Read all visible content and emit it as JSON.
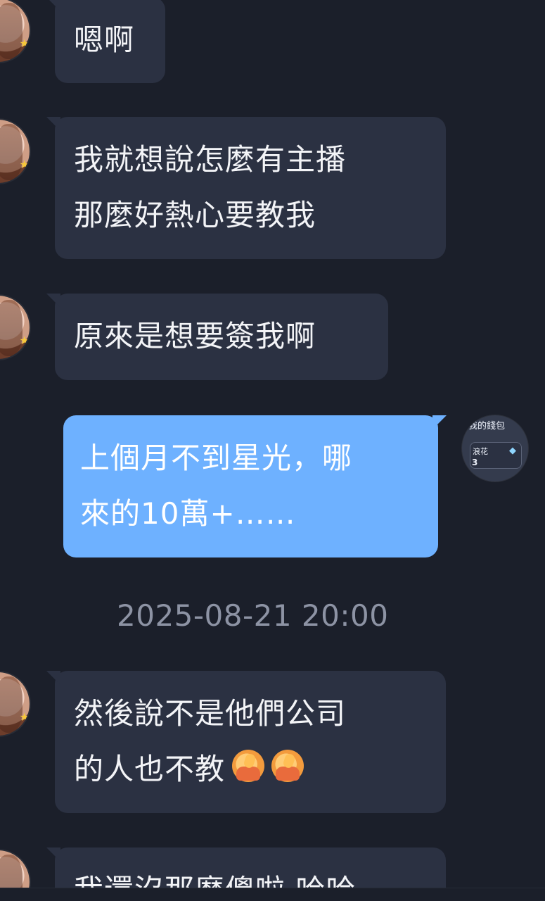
{
  "chat": {
    "messages": [
      {
        "sender": "other",
        "lines": [
          "嗯啊"
        ]
      },
      {
        "sender": "other",
        "lines": [
          "我就想說怎麼有主播",
          "那麼好熱心要教我"
        ]
      },
      {
        "sender": "other",
        "lines": [
          "原來是想要簽我啊"
        ]
      },
      {
        "sender": "self",
        "lines": [
          "上個月不到星光，哪",
          "來的10萬+……"
        ]
      },
      {
        "sender": "other",
        "lines": [
          "然後說不是他們公司",
          "的人也不教"
        ],
        "emojis": [
          "face-palm-emoji",
          "face-palm-emoji"
        ]
      },
      {
        "sender": "other",
        "lines": [
          "我還沒那麼傻啦 哈哈"
        ]
      }
    ],
    "timestamp": "2025-08-21 20:00"
  },
  "wallet": {
    "title": "我的錢包",
    "item_label": "浪花",
    "item_count": "3",
    "icon": "diamond-icon"
  },
  "colors": {
    "background": "#1b1f2a",
    "incoming_bubble": "#2b3142",
    "outgoing_bubble": "#6eb1ff",
    "timestamp": "#8d93a4"
  }
}
